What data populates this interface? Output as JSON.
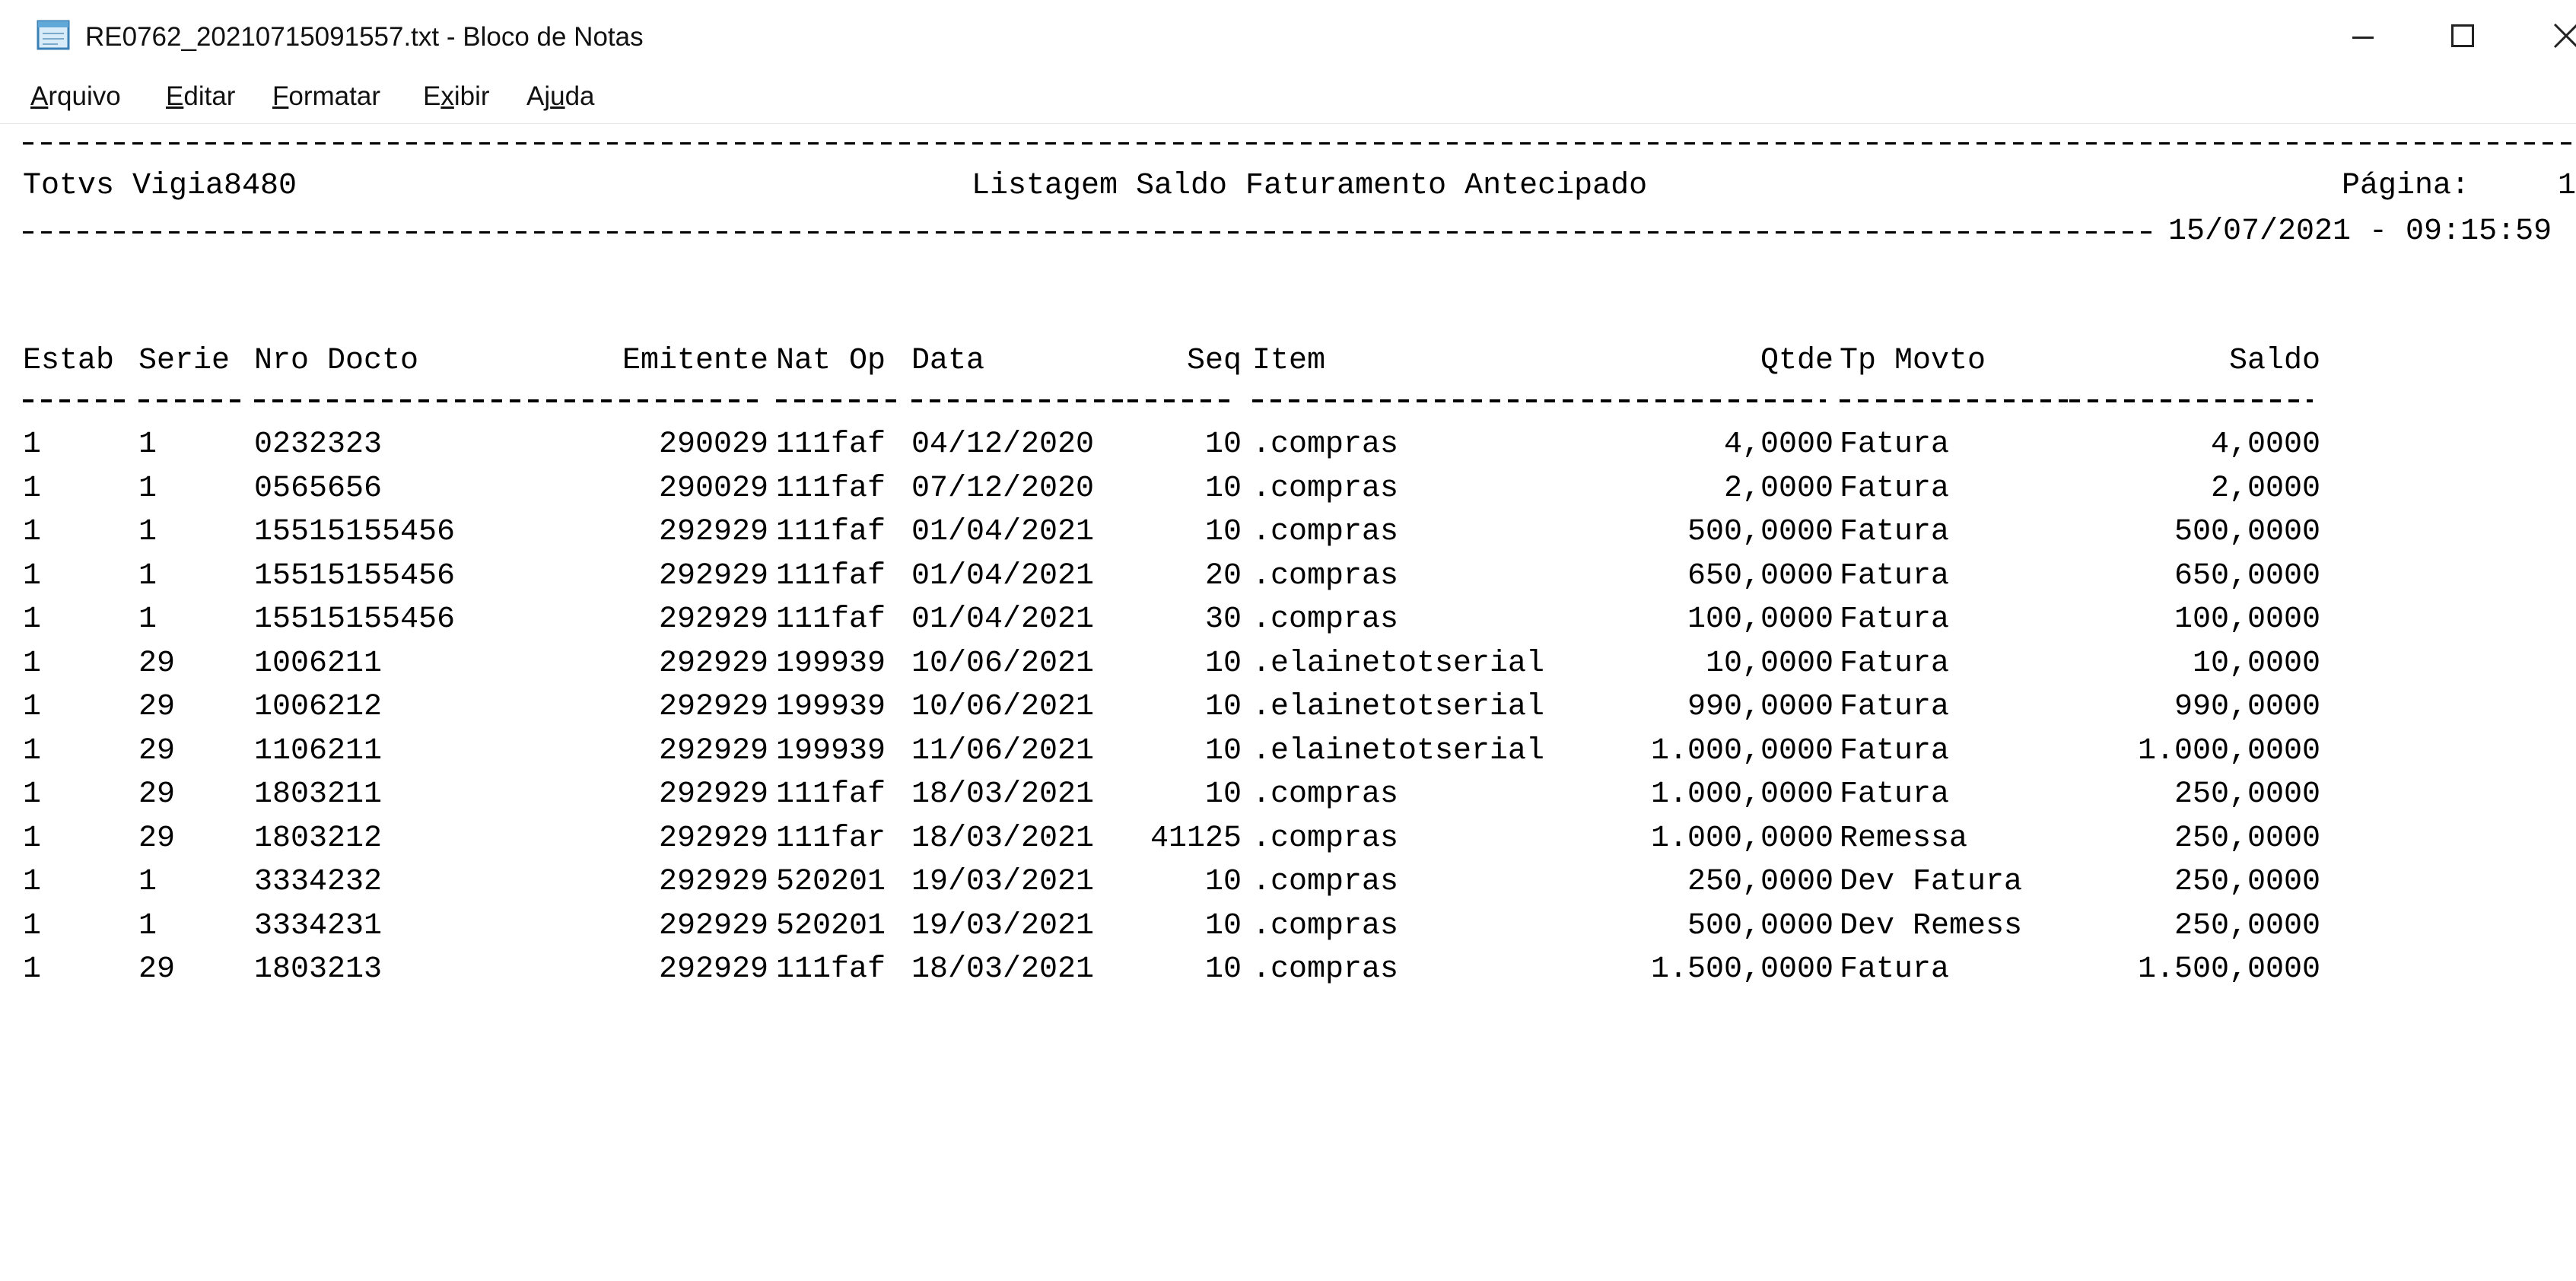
{
  "window": {
    "title": "RE0762_20210715091557.txt - Bloco de Notas",
    "icons": {
      "app": "notepad-icon",
      "minimize": "minimize-icon",
      "maximize": "maximize-icon",
      "close": "close-icon"
    }
  },
  "menu": [
    {
      "mnemonic": "A",
      "rest": "rquivo"
    },
    {
      "mnemonic": "E",
      "rest": "ditar"
    },
    {
      "mnemonic": "F",
      "rest": "ormatar"
    },
    {
      "pre": "E",
      "mnemonic": "x",
      "rest": "ibir"
    },
    {
      "pre": "Aj",
      "mnemonic": "u",
      "rest": "da"
    }
  ],
  "report": {
    "company": "Totvs Vigia8480",
    "title": "Listagem Saldo Faturamento Antecipado",
    "page_label": "Página:",
    "page_number": "1",
    "datetime": "15/07/2021 - 09:15:59",
    "columns": [
      "Estab",
      "Serie",
      "Nro Docto",
      "Emitente",
      "Nat Op",
      "Data",
      "Seq",
      "Item",
      "Qtde",
      "Tp Movto",
      "Saldo"
    ],
    "rows": [
      [
        "1",
        "1",
        "0232323",
        "290029",
        "111faf",
        "04/12/2020",
        "10",
        ".compras",
        "4,0000",
        "Fatura",
        "4,0000"
      ],
      [
        "1",
        "1",
        "0565656",
        "290029",
        "111faf",
        "07/12/2020",
        "10",
        ".compras",
        "2,0000",
        "Fatura",
        "2,0000"
      ],
      [
        "1",
        "1",
        "15515155456",
        "292929",
        "111faf",
        "01/04/2021",
        "10",
        ".compras",
        "500,0000",
        "Fatura",
        "500,0000"
      ],
      [
        "1",
        "1",
        "15515155456",
        "292929",
        "111faf",
        "01/04/2021",
        "20",
        ".compras",
        "650,0000",
        "Fatura",
        "650,0000"
      ],
      [
        "1",
        "1",
        "15515155456",
        "292929",
        "111faf",
        "01/04/2021",
        "30",
        ".compras",
        "100,0000",
        "Fatura",
        "100,0000"
      ],
      [
        "1",
        "29",
        "1006211",
        "292929",
        "199939",
        "10/06/2021",
        "10",
        ".elainetotserial",
        "10,0000",
        "Fatura",
        "10,0000"
      ],
      [
        "1",
        "29",
        "1006212",
        "292929",
        "199939",
        "10/06/2021",
        "10",
        ".elainetotserial",
        "990,0000",
        "Fatura",
        "990,0000"
      ],
      [
        "1",
        "29",
        "1106211",
        "292929",
        "199939",
        "11/06/2021",
        "10",
        ".elainetotserial",
        "1.000,0000",
        "Fatura",
        "1.000,0000"
      ],
      [
        "1",
        "29",
        "1803211",
        "292929",
        "111faf",
        "18/03/2021",
        "10",
        ".compras",
        "1.000,0000",
        "Fatura",
        "250,0000"
      ],
      [
        "1",
        "29",
        "1803212",
        "292929",
        "111far",
        "18/03/2021",
        "41125",
        ".compras",
        "1.000,0000",
        "Remessa",
        "250,0000"
      ],
      [
        "1",
        "1",
        "3334232",
        "292929",
        "520201",
        "19/03/2021",
        "10",
        ".compras",
        "250,0000",
        "Dev Fatura",
        "250,0000"
      ],
      [
        "1",
        "1",
        "3334231",
        "292929",
        "520201",
        "19/03/2021",
        "10",
        ".compras",
        "500,0000",
        "Dev Remess",
        "250,0000"
      ],
      [
        "1",
        "29",
        "1803213",
        "292929",
        "111faf",
        "18/03/2021",
        "10",
        ".compras",
        "1.500,0000",
        "Fatura",
        "1.500,0000"
      ]
    ]
  }
}
